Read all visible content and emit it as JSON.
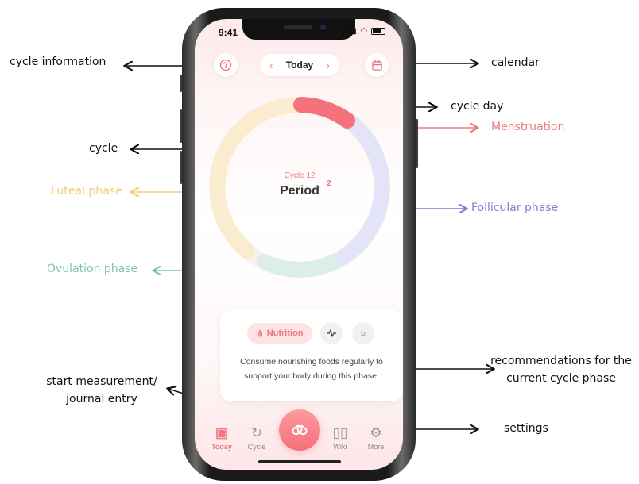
{
  "status_bar": {
    "time": "9:41"
  },
  "header": {
    "date_label": "Today",
    "prev": "‹",
    "next": "›"
  },
  "cycle": {
    "number_label": "Cycle 12",
    "status": "Period",
    "day": "2"
  },
  "recommendation": {
    "active_tab": "Nutrition",
    "text_line1": "Consume nourishing foods regularly to",
    "text_line2": "support your body during this phase."
  },
  "tabbar": {
    "today": "Today",
    "cycle": "Cycle",
    "wiki": "Wiki",
    "more": "More"
  },
  "annotations": {
    "cycle_information": "cycle information",
    "calendar": "calendar",
    "cycle_day": "cycle day",
    "menstruation": "Menstruation",
    "cycle": "cycle",
    "luteal_phase": "Luteal phase",
    "follicular_phase": "Follicular phase",
    "ovulation_phase": "Ovulation phase",
    "recommendations_line1": "recommendations for the",
    "recommendations_line2": "current cycle phase",
    "start_measurement_line1": "start measurement/",
    "start_measurement_line2": "journal entry",
    "settings": "settings"
  },
  "colors": {
    "accent": "#f0767f",
    "luteal": "#f2cf7a",
    "follicular": "#7c7fd6",
    "ovulation": "#7fc4a7"
  },
  "icons": {
    "info": "question-circle",
    "calendar": "calendar",
    "nutrition": "fork-knife",
    "activity": "pulse",
    "sun": "sun",
    "today": "calendar-check",
    "cycle": "cycle-arrow",
    "record": "heart-link",
    "wiki": "open-book",
    "more": "gear"
  }
}
